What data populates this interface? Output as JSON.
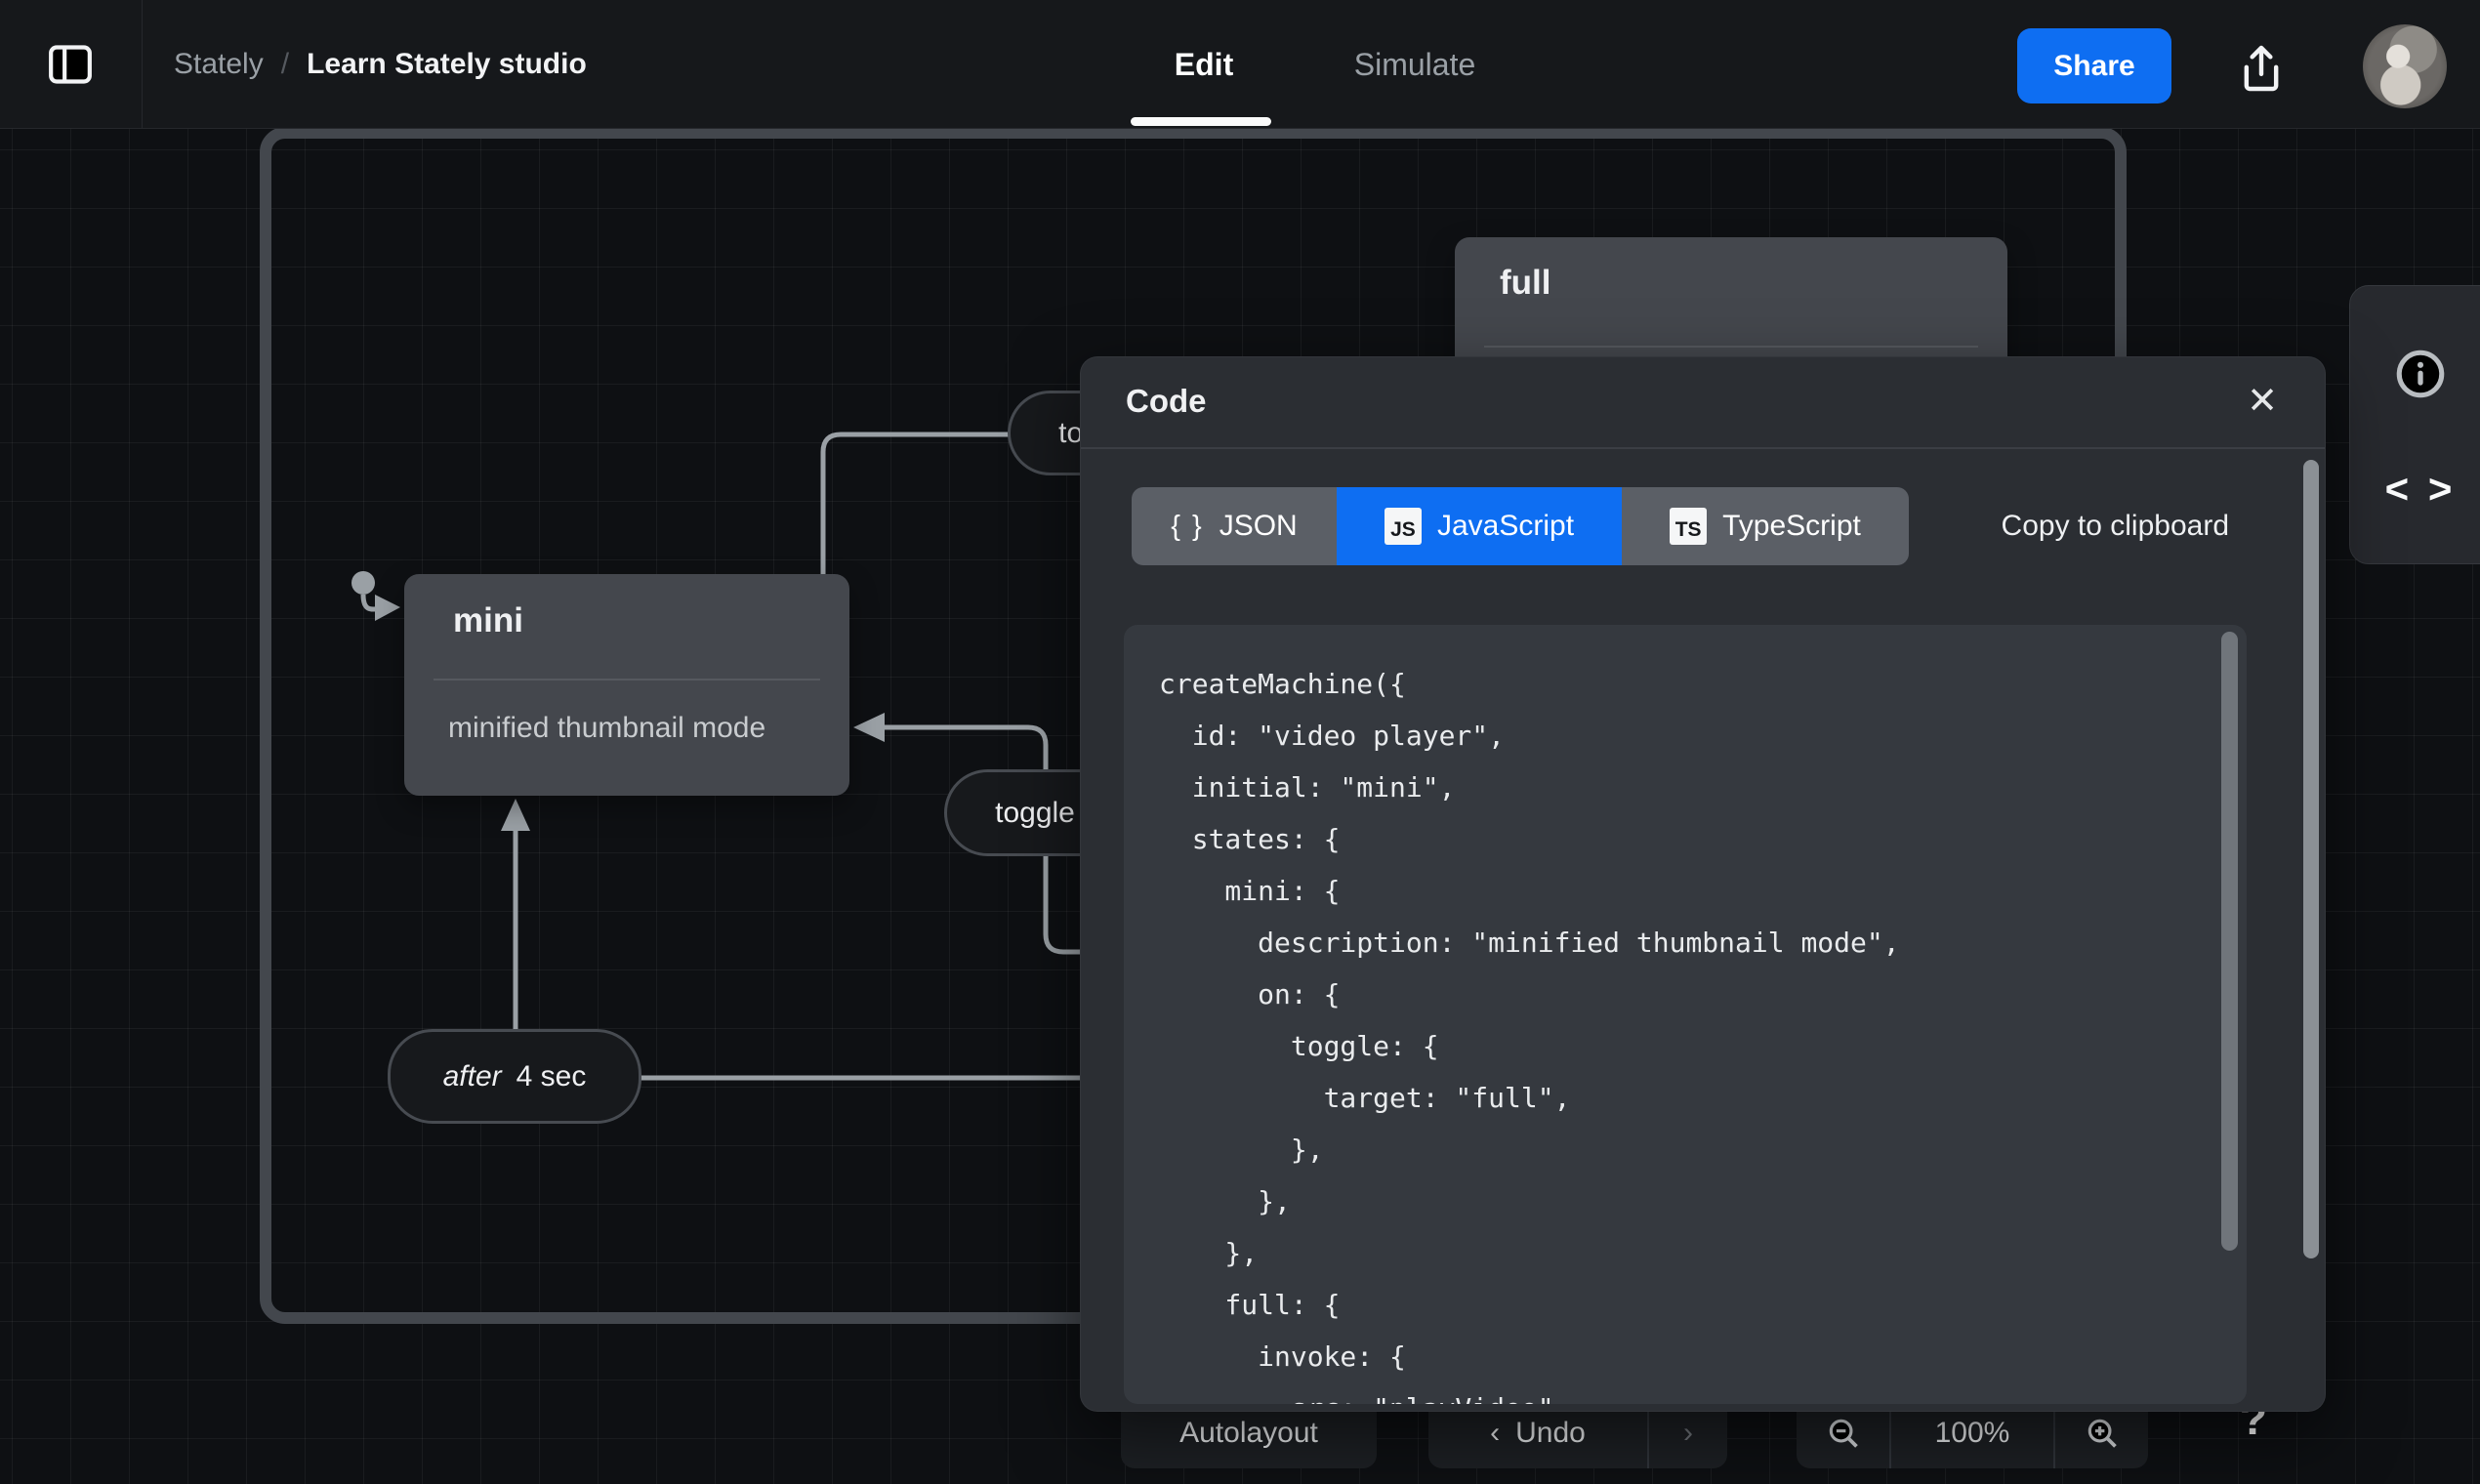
{
  "topbar": {
    "breadcrumb": {
      "app": "Stately",
      "separator": "/",
      "project": "Learn Stately studio"
    },
    "tabs": {
      "edit": "Edit",
      "simulate": "Simulate"
    },
    "share_label": "Share"
  },
  "machine": {
    "full_state": {
      "name": "full"
    },
    "mini_state": {
      "name": "mini",
      "description": "minified thumbnail mode"
    },
    "events": {
      "toggle_top": "toggle",
      "toggle_bottom": "toggle",
      "after_keyword": "after",
      "after_delay": "4 sec"
    }
  },
  "code_panel": {
    "title": "Code",
    "close_glyph": "✕",
    "tabs": [
      {
        "icon": "{ }",
        "label": "JSON"
      },
      {
        "icon": "JS",
        "label": "JavaScript"
      },
      {
        "icon": "TS",
        "label": "TypeScript"
      }
    ],
    "copy_label": "Copy to clipboard",
    "code": "createMachine({\n  id: \"video player\",\n  initial: \"mini\",\n  states: {\n    mini: {\n      description: \"minified thumbnail mode\",\n      on: {\n        toggle: {\n          target: \"full\",\n        },\n      },\n    },\n    full: {\n      invoke: {\n        src: \"playVideo\","
  },
  "right_rail": {
    "code_toggle_glyph": "< >"
  },
  "bottom_toolbar": {
    "autolayout_label": "Autolayout",
    "undo_chevron": "‹",
    "undo_label": "Undo",
    "redo_chevron": "›",
    "zoom_level": "100%",
    "help_glyph": "?"
  },
  "colors": {
    "accent_blue": "#0e6ef2",
    "state_box": "#44474d",
    "panel_bg": "#2b2e33"
  }
}
